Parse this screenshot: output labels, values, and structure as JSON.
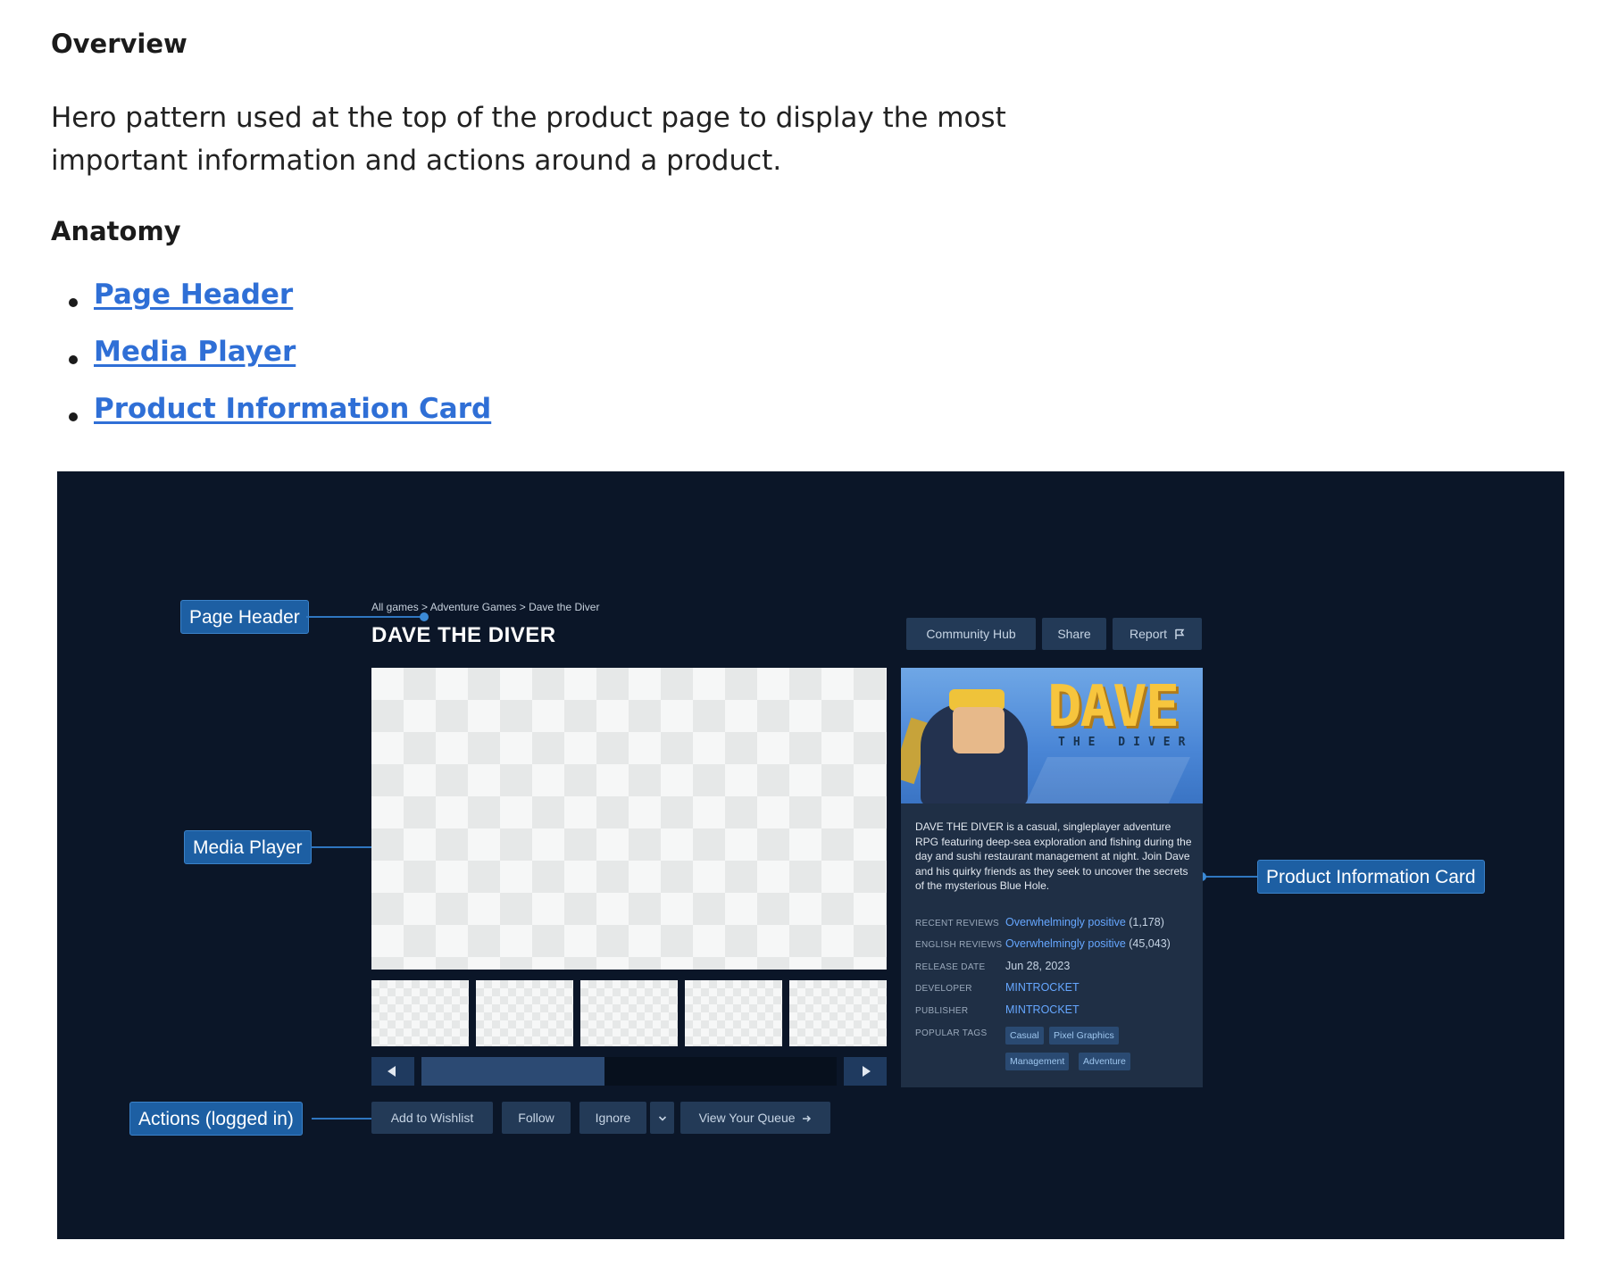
{
  "doc": {
    "overview_heading": "Overview",
    "overview_text": "Hero pattern used at the top of the product page to display the most important information and actions around a product.",
    "anatomy_heading": "Anatomy",
    "anatomy_links": [
      "Page Header",
      "Media Player",
      "Product Information Card"
    ]
  },
  "callouts": {
    "page_header": "Page Header",
    "media_player": "Media Player",
    "actions": "Actions (logged in)",
    "product_card": "Product Information Card"
  },
  "hero": {
    "breadcrumb": "All games > Adventure Games > Dave the Diver",
    "title": "DAVE THE DIVER",
    "header_buttons": {
      "community_hub": "Community Hub",
      "share": "Share",
      "report": "Report"
    },
    "media": {
      "thumbnail_count": 5,
      "scroll_position": 0.4
    },
    "actions": {
      "wishlist": "Add to Wishlist",
      "follow": "Follow",
      "ignore": "Ignore",
      "queue": "View Your Queue"
    }
  },
  "card": {
    "logo_text": "DAVE",
    "logo_subtext": "THE DIVER",
    "description": "DAVE THE DIVER is a casual, singleplayer adventure RPG featuring deep-sea exploration and fishing during the day and sushi restaurant management at night. Join Dave and his quirky friends as they seek to uncover the secrets of the mysterious Blue Hole.",
    "recent_reviews_label": "RECENT REVIEWS",
    "recent_reviews_value": "Overwhelmingly positive",
    "recent_reviews_count": "(1,178)",
    "english_reviews_label": "ENGLISH REVIEWS",
    "english_reviews_value": "Overwhelmingly positive",
    "english_reviews_count": "(45,043)",
    "release_date_label": "RELEASE DATE",
    "release_date_value": "Jun 28, 2023",
    "developer_label": "DEVELOPER",
    "developer_value": "MINTROCKET",
    "publisher_label": "PUBLISHER",
    "publisher_value": "MINTROCKET",
    "tags_label": "POPULAR TAGS",
    "tags": [
      "Casual",
      "Pixel Graphics",
      "Management",
      "Adventure"
    ]
  },
  "colors": {
    "figure_bg": "#0b1628",
    "callout_bg": "#1d5fa3",
    "button_bg": "#233a57",
    "link": "#2f6fd6",
    "card_link": "#66a7ff"
  },
  "icons": [
    "flag-icon",
    "chevron-down-icon",
    "arrow-right-icon",
    "arrow-left-icon"
  ]
}
